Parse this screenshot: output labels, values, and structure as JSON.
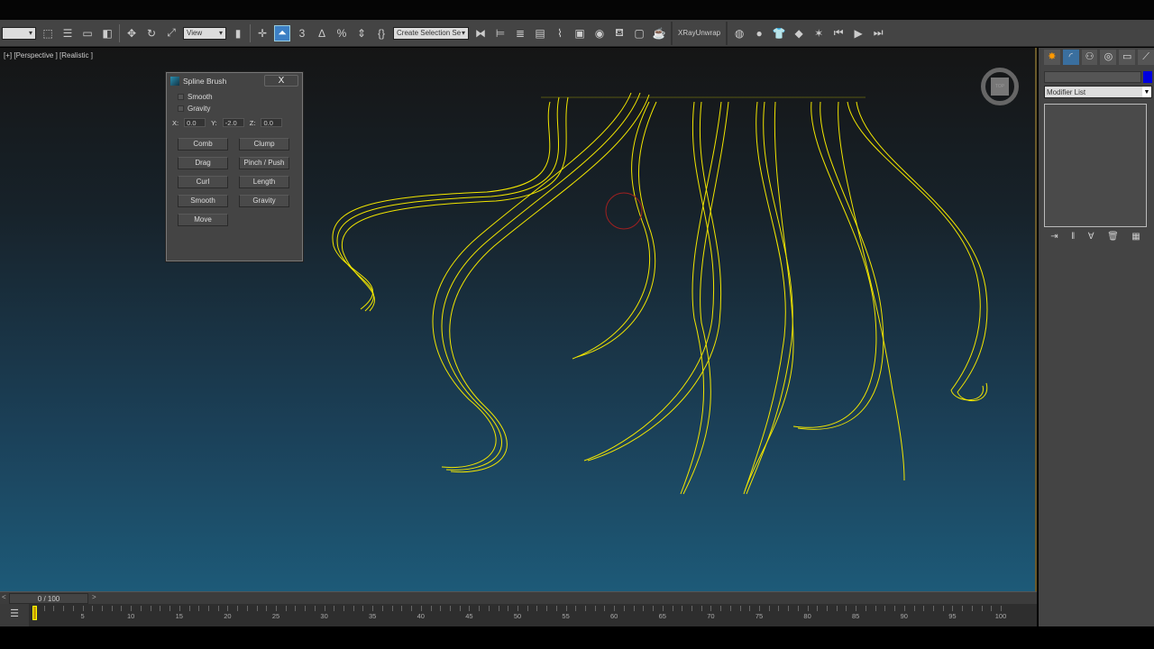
{
  "toolbar": {
    "view_select": "View",
    "selection_set": "Create Selection Se",
    "xray": "XRayUnwrap",
    "snap_label": "3"
  },
  "viewport": {
    "label": "[+] [Perspective ] [Realistic ]",
    "viewcube": "TOP"
  },
  "spline_brush": {
    "title": "Spline Brush",
    "close": "X",
    "checkboxes": [
      "Smooth",
      "Gravity"
    ],
    "x_label": "X:",
    "x": "0.0",
    "y_label": "Y:",
    "y": "-2.0",
    "z_label": "Z:",
    "z": "0.0",
    "buttons": [
      "Comb",
      "Clump",
      "Drag",
      "Pinch / Push",
      "Curl",
      "Length",
      "Smooth",
      "Gravity",
      "Move"
    ]
  },
  "command_panel": {
    "modifier_list": "Modifier List"
  },
  "timeline": {
    "frame": "0 / 100",
    "prev": "<",
    "next": ">",
    "labels": [
      "0",
      "5",
      "10",
      "15",
      "20",
      "25",
      "30",
      "35",
      "40",
      "45",
      "50",
      "55",
      "60",
      "65",
      "70",
      "75",
      "80",
      "85",
      "90",
      "95",
      "100"
    ]
  },
  "colors": {
    "spline": "#f2e600",
    "accent": "#3c7fc4"
  }
}
